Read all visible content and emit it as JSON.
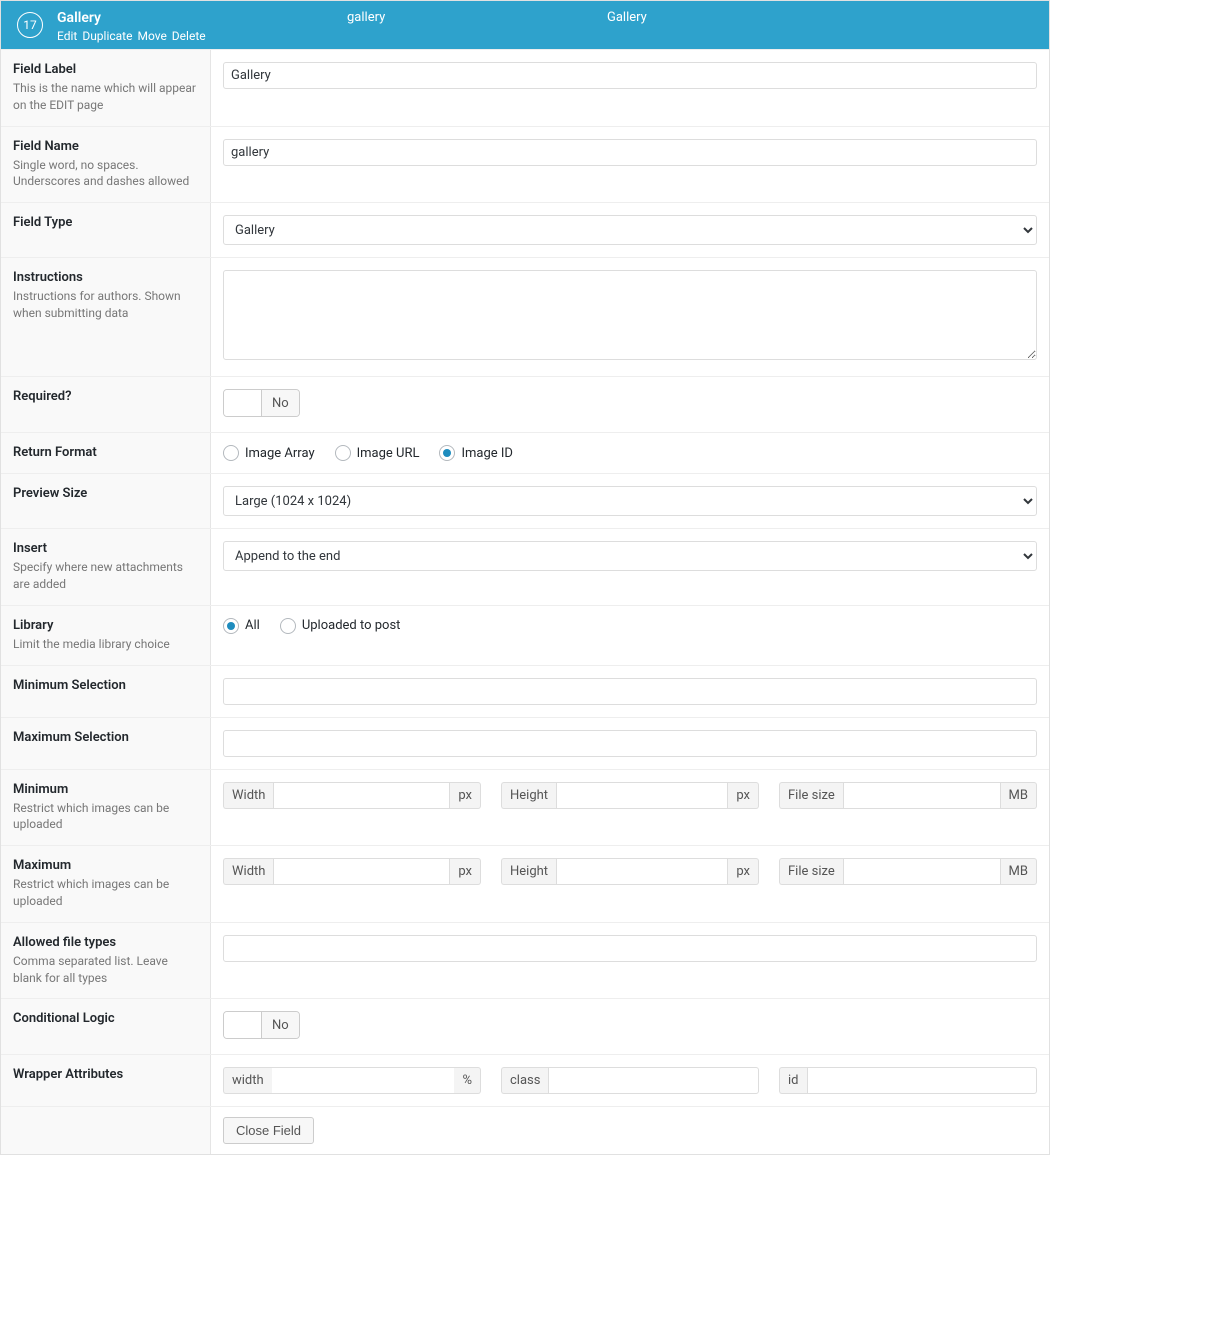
{
  "header": {
    "order": "17",
    "title": "Gallery",
    "name_slug": "gallery",
    "type": "Gallery",
    "actions": {
      "edit": "Edit",
      "duplicate": "Duplicate",
      "move": "Move",
      "delete": "Delete"
    }
  },
  "rows": {
    "field_label": {
      "label": "Field Label",
      "desc": "This is the name which will appear on the EDIT page",
      "value": "Gallery"
    },
    "field_name": {
      "label": "Field Name",
      "desc": "Single word, no spaces. Underscores and dashes allowed",
      "value": "gallery"
    },
    "field_type": {
      "label": "Field Type",
      "value": "Gallery"
    },
    "instructions": {
      "label": "Instructions",
      "desc": "Instructions for authors. Shown when submitting data",
      "value": ""
    },
    "required": {
      "label": "Required?",
      "state": "No"
    },
    "return_format": {
      "label": "Return Format",
      "options": {
        "array": "Image Array",
        "url": "Image URL",
        "id": "Image ID"
      },
      "selected": "id"
    },
    "preview_size": {
      "label": "Preview Size",
      "value": "Large (1024 x 1024)"
    },
    "insert": {
      "label": "Insert",
      "desc": "Specify where new attachments are added",
      "value": "Append to the end"
    },
    "library": {
      "label": "Library",
      "desc": "Limit the media library choice",
      "options": {
        "all": "All",
        "uploaded": "Uploaded to post"
      },
      "selected": "all"
    },
    "min_selection": {
      "label": "Minimum Selection",
      "value": ""
    },
    "max_selection": {
      "label": "Maximum Selection",
      "value": ""
    },
    "minimum": {
      "label": "Minimum",
      "desc": "Restrict which images can be uploaded",
      "width_label": "Width",
      "width_unit": "px",
      "width_value": "",
      "height_label": "Height",
      "height_unit": "px",
      "height_value": "",
      "size_label": "File size",
      "size_unit": "MB",
      "size_value": ""
    },
    "maximum": {
      "label": "Maximum",
      "desc": "Restrict which images can be uploaded",
      "width_label": "Width",
      "width_unit": "px",
      "width_value": "",
      "height_label": "Height",
      "height_unit": "px",
      "height_value": "",
      "size_label": "File size",
      "size_unit": "MB",
      "size_value": ""
    },
    "allowed_types": {
      "label": "Allowed file types",
      "desc": "Comma separated list. Leave blank for all types",
      "value": ""
    },
    "conditional_logic": {
      "label": "Conditional Logic",
      "state": "No"
    },
    "wrapper": {
      "label": "Wrapper Attributes",
      "width_label": "width",
      "width_unit": "%",
      "width_value": "",
      "class_label": "class",
      "class_value": "",
      "id_label": "id",
      "id_value": ""
    }
  },
  "footer": {
    "close": "Close Field"
  }
}
